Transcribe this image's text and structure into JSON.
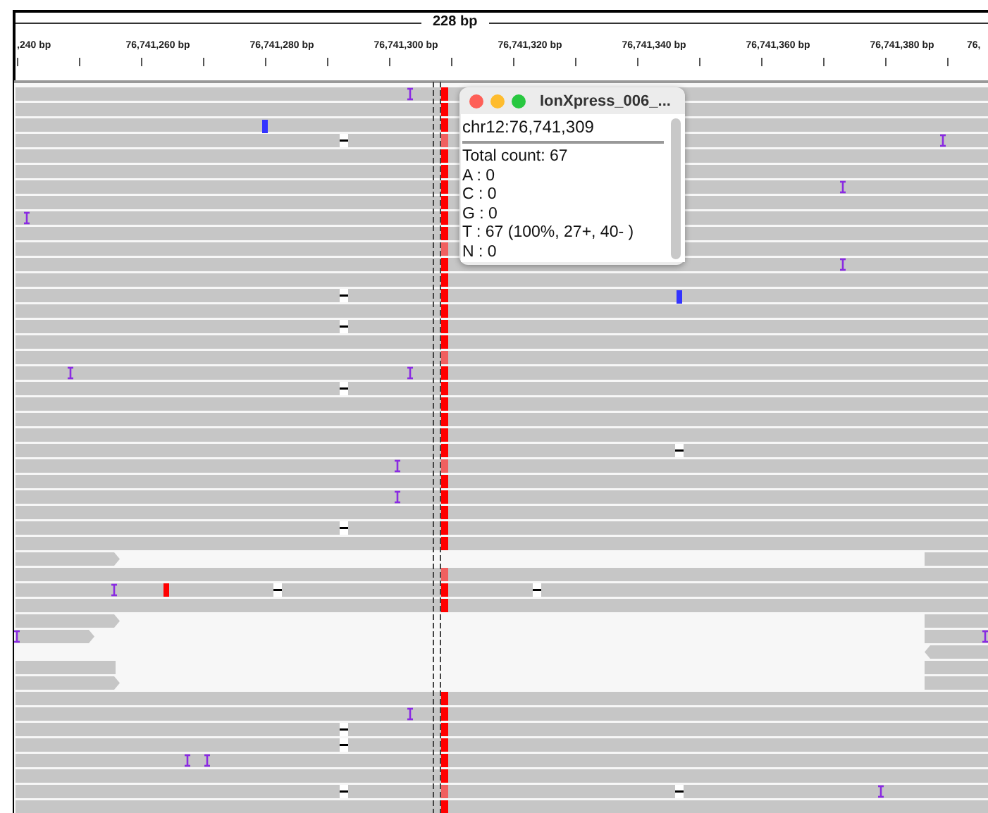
{
  "ruler": {
    "span": "228 bp",
    "ticks": [
      ",240 bp",
      "76,741,260 bp",
      "76,741,280 bp",
      "76,741,300 bp",
      "76,741,320 bp",
      "76,741,340 bp",
      "76,741,360 bp",
      "76,741,380 bp",
      "76,"
    ]
  },
  "popup": {
    "title": "IonXpress_006_...",
    "locus": "chr12:76,741,309",
    "lines": [
      "Total count: 67",
      "A : 0",
      "C : 0",
      "G : 0",
      "T : 67 (100%, 27+, 40- )",
      "N : 0"
    ]
  }
}
